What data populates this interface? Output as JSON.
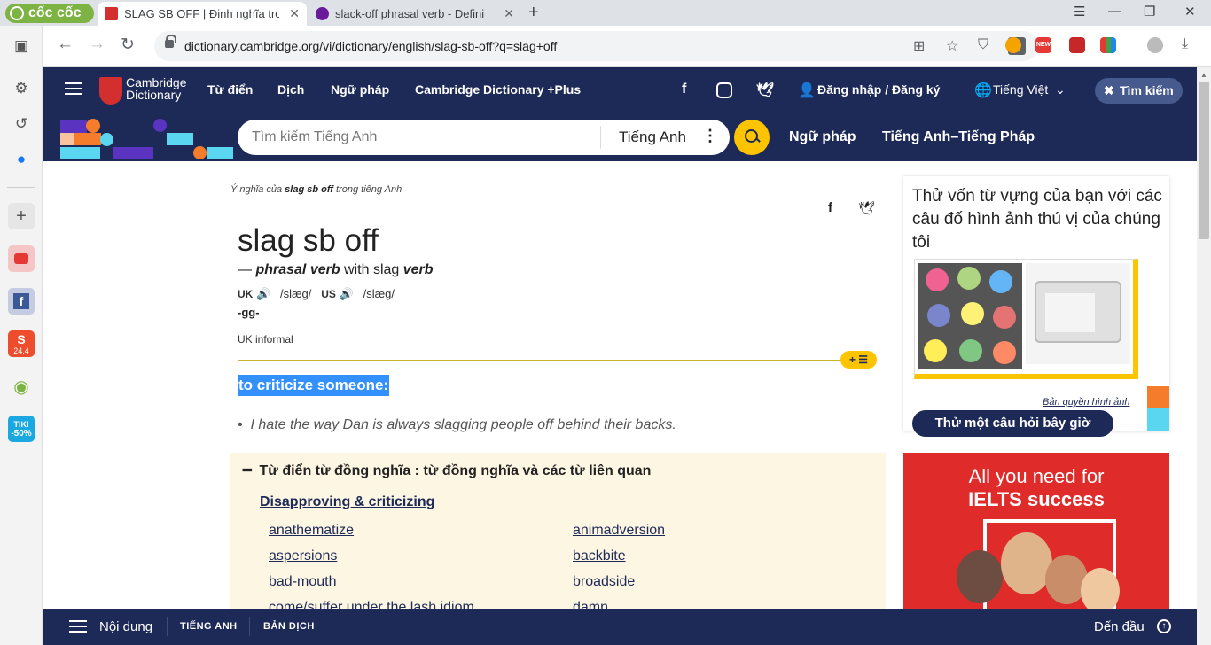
{
  "browser": {
    "logo_text": "cốc cốc",
    "tabs": [
      {
        "title": "SLAG SB OFF | Định nghĩa tro",
        "favicon_color": "#d32f2f"
      },
      {
        "title": "slack-off phrasal verb - Defini",
        "favicon_color": "#6a1b9a"
      }
    ],
    "url": "dictionary.cambridge.org/vi/dictionary/english/slag-sb-off?q=slag+off"
  },
  "sidebar_icons": [
    "panel-icon",
    "settings-icon",
    "history-icon",
    "messenger-icon",
    "add-icon",
    "youtube-icon",
    "facebook-icon",
    "shopee-icon",
    "coccoc-icon",
    "tiki-icon"
  ],
  "sidebar_tiki": "-50%",
  "sidebar_tiki_top": "TIKI",
  "sidebar_shopee": "24.4",
  "header": {
    "brand_line1": "Cambridge",
    "brand_line2": "Dictionary",
    "nav": [
      "Từ điển",
      "Dịch",
      "Ngữ pháp",
      "Cambridge Dictionary +Plus"
    ],
    "login": "Đăng nhập / Đăng ký",
    "language": "Tiếng Việt",
    "search_toggle": "Tìm kiếm"
  },
  "search": {
    "placeholder": "Tìm kiếm Tiếng Anh",
    "lang": "Tiếng Anh",
    "links": [
      "Ngữ pháp",
      "Tiếng Anh–Tiếng Pháp"
    ]
  },
  "entry": {
    "crumb_pre": "Ý nghĩa của ",
    "crumb_word": "slag sb off",
    "crumb_post": " trong tiếng Anh",
    "headword": "slag sb off",
    "pos_dash": "— ",
    "pos": "phrasal verb",
    "pos_with": " with slag ",
    "pos_verb": "verb",
    "uk": "UK",
    "uk_ipa": "/slæɡ/",
    "us": "US",
    "us_ipa": "/slæɡ/",
    "inflection": "-gg-",
    "register": "UK informal",
    "pill": "+ ☰",
    "definition": "to criticize someone:",
    "example": "I hate the way Dan is always slagging people off behind their backs."
  },
  "thesaurus": {
    "title": "Từ điển từ đồng nghĩa : từ đồng nghĩa và các từ liên quan",
    "category": "Disapproving & criticizing",
    "left": [
      "anathematize",
      "aspersions",
      "bad-mouth",
      "come/suffer under the lash idiom"
    ],
    "right": [
      "animadversion",
      "backbite",
      "broadside",
      "damn"
    ]
  },
  "quiz": {
    "title": "Thử vốn từ vựng của bạn với các câu đố hình ảnh thú vị của chúng tôi",
    "credit": "Bản quyền hình ảnh",
    "button": "Thử một câu hỏi bây giờ"
  },
  "ad": {
    "line1": "All you need for",
    "line2": "IELTS success"
  },
  "bottom": {
    "menu": "Nội dung",
    "tab1": "TIẾNG ANH",
    "tab2": "BẢN DỊCH",
    "top": "Đến đầu"
  }
}
